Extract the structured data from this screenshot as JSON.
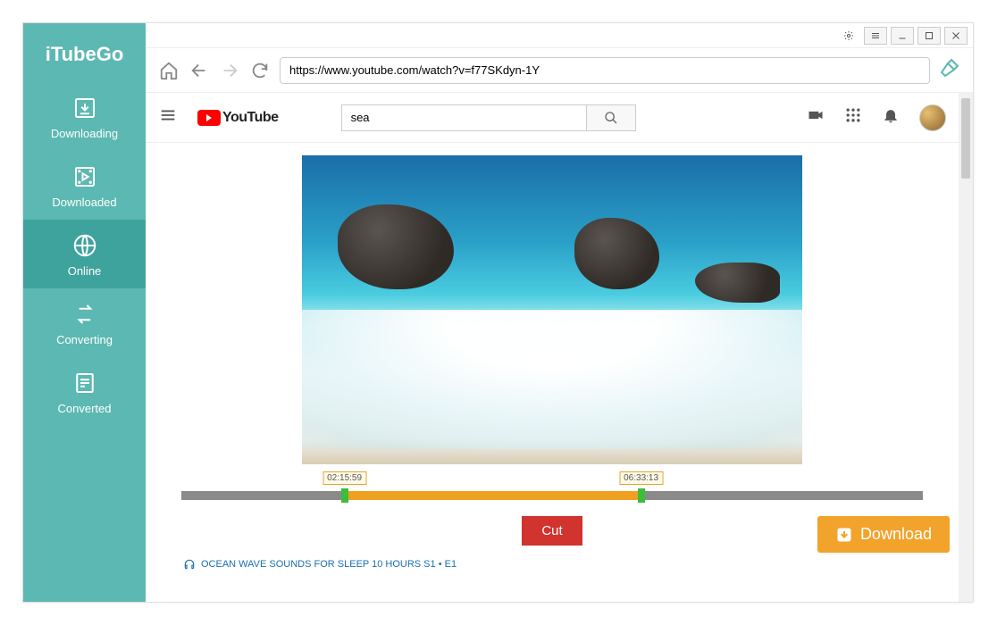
{
  "brand": "iTubeGo",
  "sidebar": {
    "items": [
      {
        "label": "Downloading",
        "id": "downloading"
      },
      {
        "label": "Downloaded",
        "id": "downloaded"
      },
      {
        "label": "Online",
        "id": "online"
      },
      {
        "label": "Converting",
        "id": "converting"
      },
      {
        "label": "Converted",
        "id": "converted"
      }
    ],
    "active_index": 2
  },
  "address_bar": {
    "url": "https://www.youtube.com/watch?v=f77SKdyn-1Y"
  },
  "youtube": {
    "logo_text": "YouTube",
    "search_value": "sea"
  },
  "timeline": {
    "start_label": "02:15:59",
    "end_label": "06:33:13",
    "start_pct": 22,
    "end_pct": 62
  },
  "buttons": {
    "cut": "Cut",
    "download": "Download"
  },
  "caption": "OCEAN WAVE SOUNDS FOR SLEEP 10 HOURS  S1 • E1"
}
